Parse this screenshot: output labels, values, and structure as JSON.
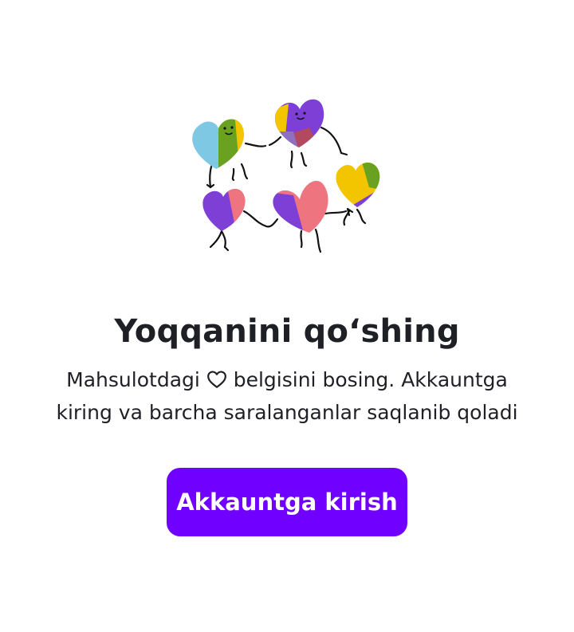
{
  "empty_state": {
    "title": "Yoqqanini qo‘shing",
    "subtitle_before_icon": "Mahsulotdagi",
    "subtitle_after_icon": "belgisini bosing. Akkauntga",
    "subtitle_line2": "kiring va barcha saralanganlar saqlanib qoladi",
    "inline_icon": "heart-outline-icon",
    "illustration": "dancing-hearts-illustration"
  },
  "login_button": {
    "label": "Akkauntga kirish"
  },
  "colors": {
    "accent": "#7000ff",
    "text": "#1f2026",
    "background": "#ffffff"
  }
}
